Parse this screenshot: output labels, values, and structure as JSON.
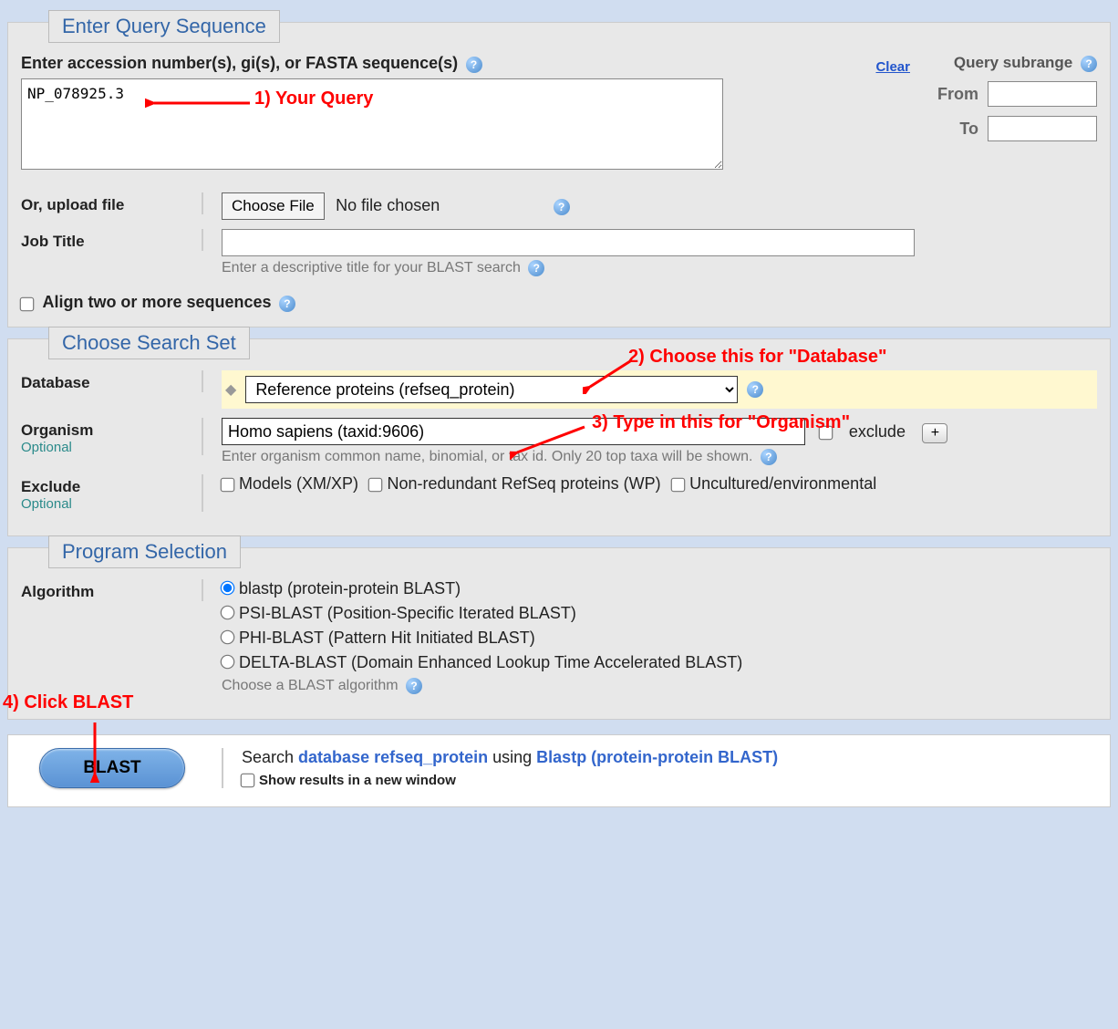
{
  "query": {
    "section_title": "Enter Query Sequence",
    "field_label": "Enter accession number(s), gi(s), or FASTA sequence(s)",
    "textarea_value": "NP_078925.3",
    "clear": "Clear",
    "subrange_title": "Query subrange",
    "from_label": "From",
    "to_label": "To",
    "upload_label": "Or, upload file",
    "choose_file": "Choose File",
    "no_file": "No file chosen",
    "job_title_label": "Job Title",
    "job_title_hint": "Enter a descriptive title for your BLAST search",
    "align_label": "Align two or more sequences"
  },
  "search_set": {
    "section_title": "Choose Search Set",
    "database_label": "Database",
    "database_value": "Reference proteins (refseq_protein)",
    "organism_label": "Organism",
    "optional": "Optional",
    "organism_value": "Homo sapiens (taxid:9606)",
    "exclude_cb": "exclude",
    "organism_hint": "Enter organism common name, binomial, or tax id. Only 20 top taxa will be shown.",
    "exclude_label": "Exclude",
    "exclude_models": "Models (XM/XP)",
    "exclude_wp": "Non-redundant RefSeq proteins (WP)",
    "exclude_env": "Uncultured/environmental"
  },
  "program": {
    "section_title": "Program Selection",
    "algorithm_label": "Algorithm",
    "algos": {
      "blastp": "blastp (protein-protein BLAST)",
      "psi": "PSI-BLAST (Position-Specific Iterated BLAST)",
      "phi": "PHI-BLAST (Pattern Hit Initiated BLAST)",
      "delta": "DELTA-BLAST (Domain Enhanced Lookup Time Accelerated BLAST)"
    },
    "hint": "Choose a BLAST algorithm"
  },
  "blast": {
    "button": "BLAST",
    "search_prefix": "Search ",
    "database": "database refseq_protein",
    "using": " using ",
    "program": "Blastp (protein-protein BLAST)",
    "show_results": "Show results in a new window"
  },
  "annotations": {
    "a1": "1) Your Query",
    "a2": "2) Choose this for \"Database\"",
    "a3": "3) Type in this for \"Organism\"",
    "a4": "4) Click BLAST"
  }
}
